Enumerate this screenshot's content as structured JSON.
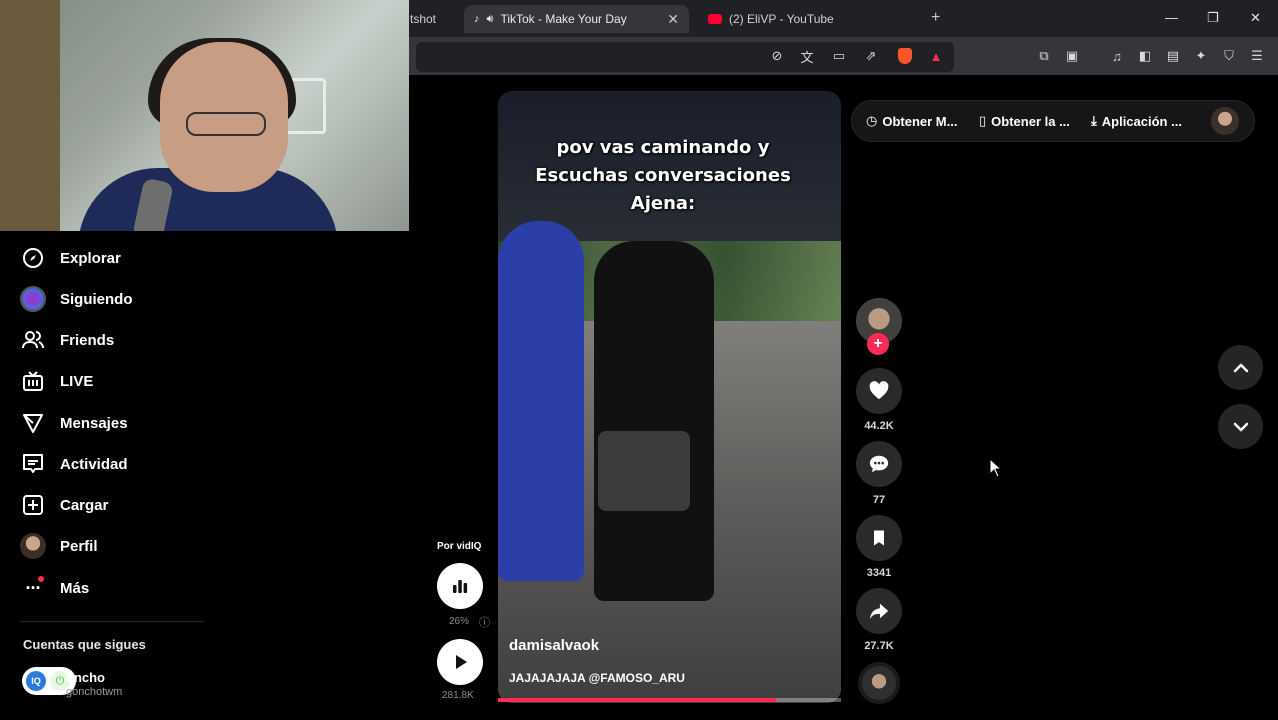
{
  "browser": {
    "tabs": [
      {
        "label": "tshot"
      },
      {
        "label": "TikTok - Make Your Day",
        "active": true
      },
      {
        "label": "(2) EliVP - YouTube"
      }
    ],
    "new_tab_icon": "plus-icon"
  },
  "topbar": {
    "item1": "Obtener M...",
    "item2": "Obtener la ...",
    "item3": "Aplicación ..."
  },
  "nav": {
    "explorar": "Explorar",
    "siguiendo": "Siguiendo",
    "friends": "Friends",
    "live": "LIVE",
    "mensajes": "Mensajes",
    "actividad": "Actividad",
    "cargar": "Cargar",
    "perfil": "Perfil",
    "mas": "Más"
  },
  "following": {
    "title": "Cuentas que sigues",
    "account_name": "oncho",
    "account_handle": "gonchotwm"
  },
  "video": {
    "caption_line1": "pov vas caminando y",
    "caption_line2": "Escuchas conversaciones",
    "caption_line3": "Ajena:",
    "author": "damisalvaok",
    "description": "JAJAJAJAJA @FAMOSO_ARU",
    "progress": 0.81
  },
  "vidiq": {
    "label": "Por vidIQ",
    "score": "26%",
    "views": "281.8K"
  },
  "actions": {
    "likes": "44.2K",
    "comments": "77",
    "saves": "3341",
    "shares": "27.7K"
  },
  "colors": {
    "accent": "#fe2c55",
    "background": "#000000"
  }
}
